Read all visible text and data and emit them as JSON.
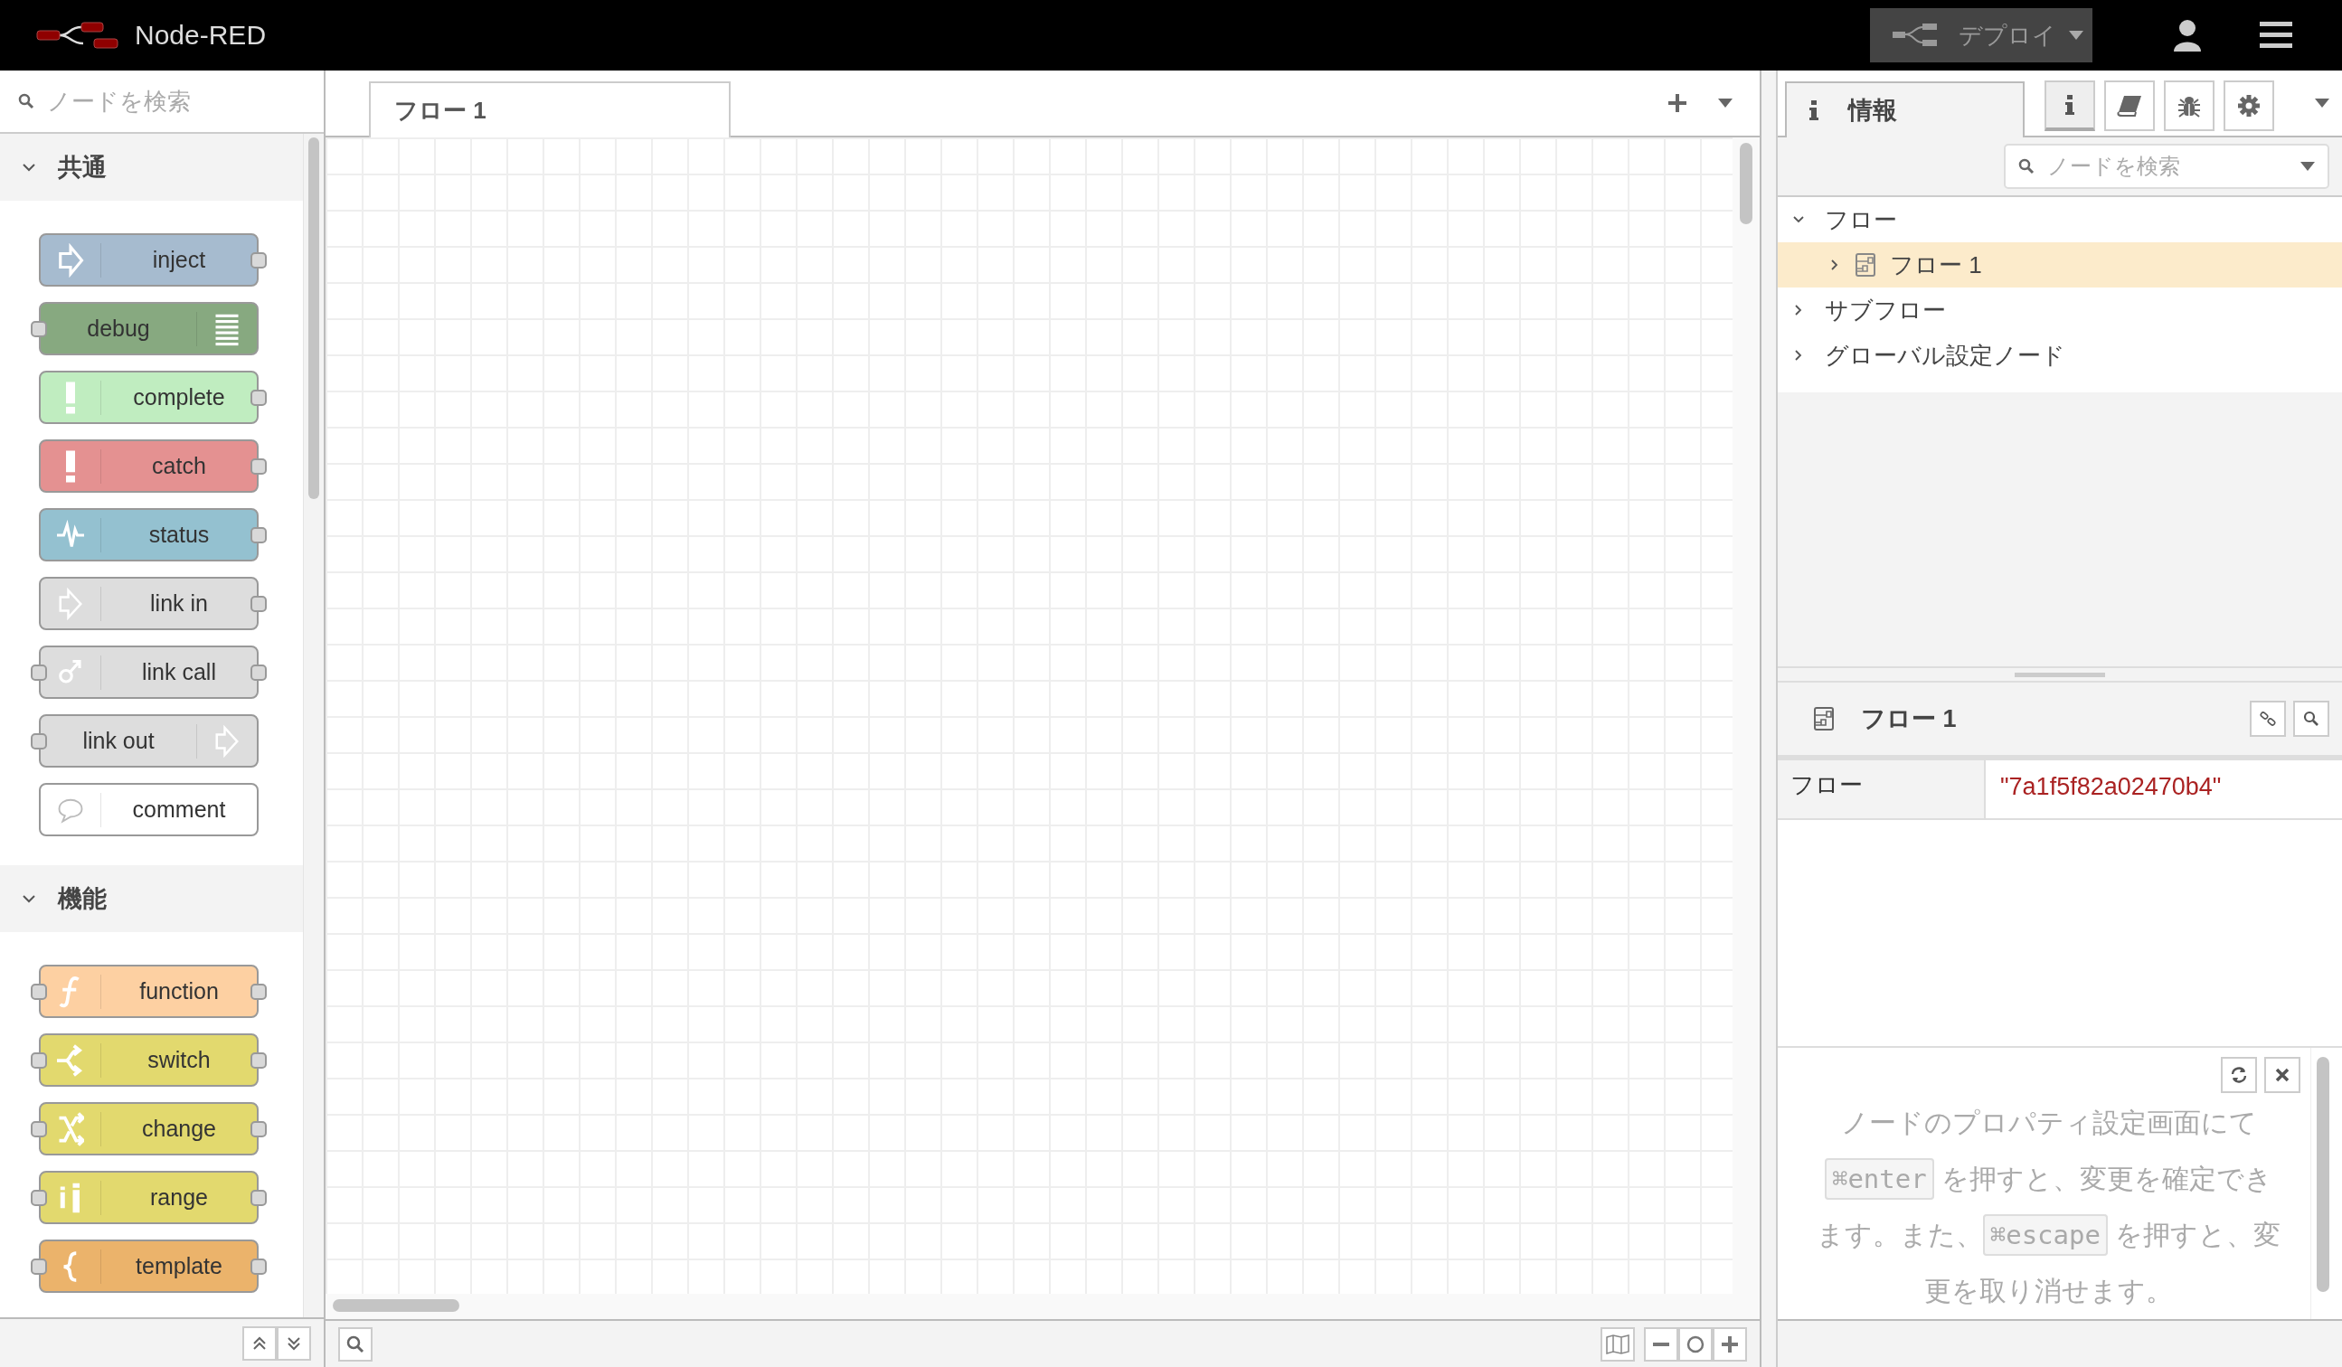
{
  "header": {
    "title": "Node-RED",
    "deploy_label": "デプロイ",
    "deploy_disabled": true
  },
  "palette": {
    "search_placeholder": "ノードを検索",
    "categories": [
      {
        "name": "共通",
        "expanded": true,
        "nodes": [
          {
            "label": "inject",
            "color": "#a6bbcf",
            "kind": "inject",
            "icon_right": false,
            "input": false,
            "output": true
          },
          {
            "label": "debug",
            "color": "#87a980",
            "kind": "debug",
            "icon_right": true,
            "input": true,
            "output": false
          },
          {
            "label": "complete",
            "color": "#c0edc0",
            "kind": "alert",
            "icon_right": false,
            "input": false,
            "output": true
          },
          {
            "label": "catch",
            "color": "#e49191",
            "kind": "alert",
            "icon_right": false,
            "input": false,
            "output": true
          },
          {
            "label": "status",
            "color": "#94c1d0",
            "kind": "pulse",
            "icon_right": false,
            "input": false,
            "output": true
          },
          {
            "label": "link in",
            "color": "#dddddd",
            "kind": "link",
            "icon_right": false,
            "input": false,
            "output": true
          },
          {
            "label": "link call",
            "color": "#dddddd",
            "kind": "linkcall",
            "icon_right": false,
            "input": true,
            "output": true
          },
          {
            "label": "link out",
            "color": "#dddddd",
            "kind": "link",
            "icon_right": true,
            "input": true,
            "output": false
          },
          {
            "label": "comment",
            "color": "#ffffff",
            "kind": "comment",
            "icon_right": false,
            "input": false,
            "output": false
          }
        ]
      },
      {
        "name": "機能",
        "expanded": true,
        "nodes": [
          {
            "label": "function",
            "color": "#fdd0a2",
            "kind": "function",
            "icon_right": false,
            "input": true,
            "output": true
          },
          {
            "label": "switch",
            "color": "#e2d96e",
            "kind": "switch",
            "icon_right": false,
            "input": true,
            "output": true
          },
          {
            "label": "change",
            "color": "#e2d96e",
            "kind": "change",
            "icon_right": false,
            "input": true,
            "output": true
          },
          {
            "label": "range",
            "color": "#e2d96e",
            "kind": "range",
            "icon_right": false,
            "input": true,
            "output": true
          },
          {
            "label": "template",
            "color": "#ebb36b",
            "kind": "template",
            "icon_right": false,
            "input": true,
            "output": true
          }
        ]
      }
    ]
  },
  "workspace": {
    "tabs": [
      {
        "label": "フロー 1",
        "selected": true
      }
    ]
  },
  "sidebar": {
    "tab_label": "情報",
    "tab_buttons": [
      {
        "kind": "info",
        "selected": true
      },
      {
        "kind": "book",
        "selected": false
      },
      {
        "kind": "bug",
        "selected": false
      },
      {
        "kind": "gear",
        "selected": false
      }
    ],
    "search_placeholder": "ノードを検索",
    "tree": [
      {
        "label": "フロー",
        "expanded": true,
        "selected": false,
        "children": [
          {
            "label": "フロー 1",
            "expanded": false,
            "selected": true
          }
        ]
      },
      {
        "label": "サブフロー",
        "expanded": false,
        "selected": false
      },
      {
        "label": "グローバル設定ノード",
        "expanded": false,
        "selected": false
      }
    ],
    "details": {
      "title": "フロー 1",
      "rows": [
        {
          "key": "フロー",
          "value": "\"7a1f5f82a02470b4\""
        }
      ]
    },
    "tip": [
      {
        "kind": "text",
        "text": "ノードのプロパティ設定画面にて"
      },
      {
        "kind": "key",
        "text": "⌘enter"
      },
      {
        "kind": "text",
        "text": " を押すと、変更を確定できます。また、"
      },
      {
        "kind": "key",
        "text": "⌘escape"
      },
      {
        "kind": "text",
        "text": " を押すと、変更を取り消せます。"
      }
    ]
  }
}
